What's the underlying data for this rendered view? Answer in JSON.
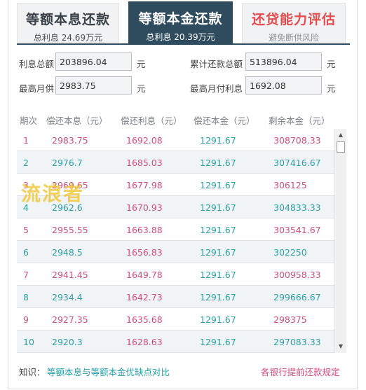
{
  "tabs": [
    {
      "title": "等额本息还款",
      "subtitle": "总利息 24.69万元"
    },
    {
      "title": "等额本金还款",
      "subtitle": "总利息 20.39万元"
    },
    {
      "title": "还贷能力评估",
      "subtitle": "避免断供风险"
    }
  ],
  "summary": {
    "total_interest_label": "利息总额",
    "total_interest_value": "203896.04",
    "total_repay_label": "累计还款总额",
    "total_repay_value": "513896.04",
    "max_monthly_label": "最高月供",
    "max_monthly_value": "2983.75",
    "max_interest_label": "最高月付利息",
    "max_interest_value": "1692.08",
    "unit": "元"
  },
  "table": {
    "headers": [
      "期次",
      "偿还本息（元）",
      "偿还利息（元）",
      "偿还本金（元）",
      "剩余本金（元）"
    ],
    "rows": [
      [
        "1",
        "2983.75",
        "1692.08",
        "1291.67",
        "308708.33"
      ],
      [
        "2",
        "2976.7",
        "1685.03",
        "1291.67",
        "307416.67"
      ],
      [
        "3",
        "2969.65",
        "1677.98",
        "1291.67",
        "306125"
      ],
      [
        "4",
        "2962.6",
        "1670.93",
        "1291.67",
        "304833.33"
      ],
      [
        "5",
        "2955.55",
        "1663.88",
        "1291.67",
        "303541.67"
      ],
      [
        "6",
        "2948.5",
        "1656.83",
        "1291.67",
        "302250"
      ],
      [
        "7",
        "2941.45",
        "1649.78",
        "1291.67",
        "300958.33"
      ],
      [
        "8",
        "2934.4",
        "1642.73",
        "1291.67",
        "299666.67"
      ],
      [
        "9",
        "2927.35",
        "1635.68",
        "1291.67",
        "298375"
      ],
      [
        "10",
        "2920.3",
        "1628.63",
        "1291.67",
        "297083.33"
      ]
    ]
  },
  "footer": {
    "label": "知识：",
    "link_compare": "等额本息与等额本金优缺点对比",
    "link_rules": "各银行提前还款规定"
  },
  "watermark": "流浪者"
}
